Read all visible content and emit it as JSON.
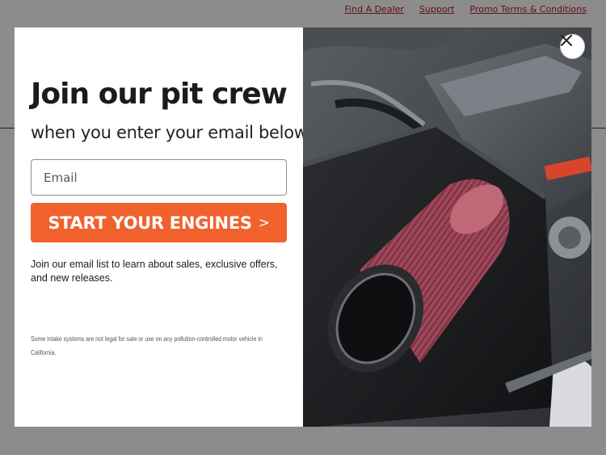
{
  "header": {
    "links": [
      "Find A Dealer",
      "Support",
      "Promo Terms & Conditions"
    ]
  },
  "modal": {
    "headline": "Join our pit crew",
    "subhead": "when you enter your email below.",
    "email_placeholder": "Email",
    "cta_label": "START YOUR ENGINES",
    "cta_chevron": ">",
    "info_text": "Join our email list to learn about sales, exclusive offers, and new releases.",
    "legal_text": "Some intake systems are not legal for sale or use on any pollution-controlled motor vehicle in California.",
    "close_icon": "close-icon",
    "image_subject": "engine-air-filter-image"
  },
  "colors": {
    "accent": "#f0612e",
    "link": "#b3202b",
    "filter": "#a84a5a"
  }
}
